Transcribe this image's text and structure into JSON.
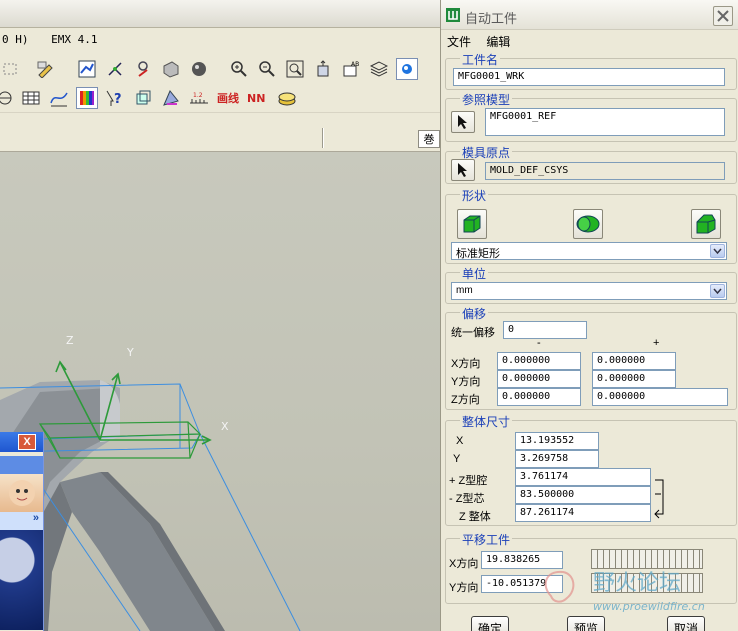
{
  "cad": {
    "menu": [
      "0 H)",
      "EMX 4.1"
    ],
    "strip_tag": "巻",
    "mini_close": "X",
    "mini_chevron": "»",
    "axes": {
      "x": "X",
      "y": "Y",
      "z": "Z"
    }
  },
  "dialog": {
    "title": "自动工件",
    "menu": {
      "file": "文件",
      "edit": "编辑"
    },
    "workpiece_name": {
      "label": "工件名",
      "value": "MFG0001_WRK"
    },
    "ref_model": {
      "label": "参照模型",
      "value": "MFG0001_REF"
    },
    "mold_origin": {
      "label": "模具原点",
      "value": "MOLD_DEF_CSYS"
    },
    "shape": {
      "label": "形状",
      "selected": "标准矩形"
    },
    "units": {
      "label": "单位",
      "selected": "mm"
    },
    "offset": {
      "label": "偏移",
      "uniform_label": "统一偏移",
      "uniform_value": "0",
      "minus": "-",
      "plus": "+",
      "rows": [
        {
          "label": "X方向",
          "minus": "0.000000",
          "plus": "0.000000"
        },
        {
          "label": "Y方向",
          "minus": "0.000000",
          "plus": "0.000000"
        },
        {
          "label": "Z方向",
          "minus": "0.000000",
          "plus": "0.000000"
        }
      ]
    },
    "overall": {
      "label": "整体尺寸",
      "x_label": "X",
      "x_value": "13.193552",
      "y_label": "Y",
      "y_value": "3.269758",
      "zcavity_label": "+ Z型腔",
      "zcavity_value": "3.761174",
      "zcore_label": "- Z型芯",
      "zcore_value": "83.500000",
      "ztotal_label": "Z 整体",
      "ztotal_value": "87.261174"
    },
    "translate": {
      "label": "平移工件",
      "x_label": "X方向",
      "x_value": "19.838265",
      "y_label": "Y方向",
      "y_value": "-10.051379"
    },
    "buttons": {
      "ok": "确定",
      "preview": "预览",
      "cancel": "取消"
    }
  },
  "watermark": {
    "name": "野火论坛",
    "url": "www.proewildfire.cn"
  },
  "colors": {
    "dialog_group_label": "#1a3fb8",
    "shape_green": "#22b322",
    "axis_green": "#2d9a3a",
    "wire_blue": "#3c8ee0"
  }
}
